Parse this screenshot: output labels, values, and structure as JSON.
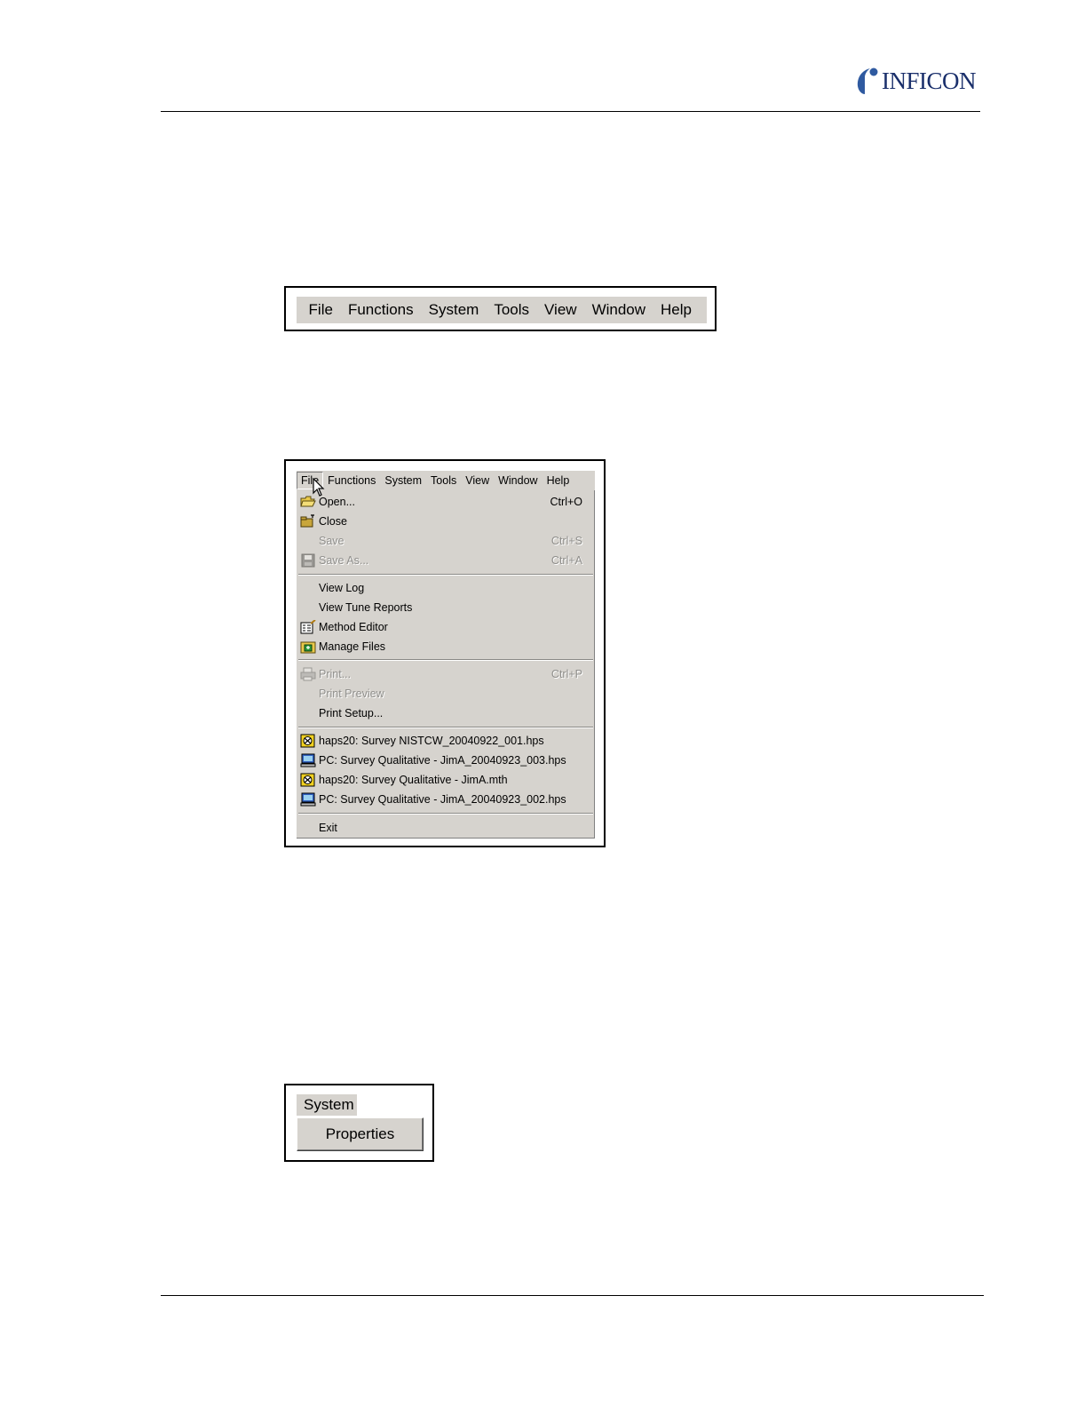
{
  "header": {
    "logo_text": "INFICON"
  },
  "figure1": {
    "menu": [
      "File",
      "Functions",
      "System",
      "Tools",
      "View",
      "Window",
      "Help"
    ]
  },
  "figure2": {
    "menubar": [
      "File",
      "Functions",
      "System",
      "Tools",
      "View",
      "Window",
      "Help"
    ],
    "active_menu": "File",
    "items": [
      {
        "label": "Open...",
        "shortcut": "Ctrl+O",
        "enabled": true,
        "icon": "open-folder-icon"
      },
      {
        "label": "Close",
        "shortcut": "",
        "enabled": true,
        "icon": "close-folder-icon"
      },
      {
        "label": "Save",
        "shortcut": "Ctrl+S",
        "enabled": false,
        "icon": ""
      },
      {
        "label": "Save As...",
        "shortcut": "Ctrl+A",
        "enabled": false,
        "icon": "floppy-disk-icon"
      },
      {
        "label": "View Log",
        "shortcut": "",
        "enabled": true,
        "icon": ""
      },
      {
        "label": "View Tune Reports",
        "shortcut": "",
        "enabled": true,
        "icon": ""
      },
      {
        "label": "Method Editor",
        "shortcut": "",
        "enabled": true,
        "icon": "method-editor-icon"
      },
      {
        "label": "Manage Files",
        "shortcut": "",
        "enabled": true,
        "icon": "manage-files-icon"
      },
      {
        "label": "Print...",
        "shortcut": "Ctrl+P",
        "enabled": false,
        "icon": "printer-icon"
      },
      {
        "label": "Print Preview",
        "shortcut": "",
        "enabled": false,
        "icon": ""
      },
      {
        "label": "Print Setup...",
        "shortcut": "",
        "enabled": true,
        "icon": ""
      },
      {
        "label": "haps20: Survey NISTCW_20040922_001.hps",
        "shortcut": "",
        "enabled": true,
        "icon": "hapsite-file-icon"
      },
      {
        "label": "PC: Survey Qualitative - JimA_20040923_003.hps",
        "shortcut": "",
        "enabled": true,
        "icon": "pc-file-icon"
      },
      {
        "label": "haps20: Survey Qualitative - JimA.mth",
        "shortcut": "",
        "enabled": true,
        "icon": "hapsite-file-icon"
      },
      {
        "label": "PC: Survey Qualitative - JimA_20040923_002.hps",
        "shortcut": "",
        "enabled": true,
        "icon": "pc-file-icon"
      },
      {
        "label": "Exit",
        "shortcut": "",
        "enabled": true,
        "icon": ""
      }
    ]
  },
  "figure3": {
    "menu_label": "System",
    "button_label": "Properties"
  },
  "colors": {
    "menu_background": "#d6d3ce",
    "logo_blue": "#1a2f6b",
    "disabled_text": "#8f8e8b"
  }
}
